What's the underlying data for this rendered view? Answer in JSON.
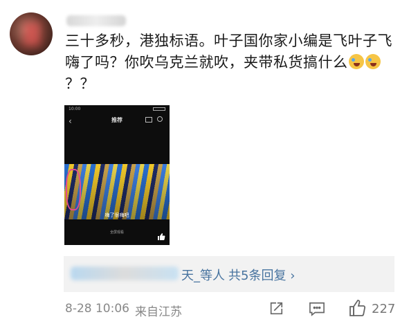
{
  "comment": {
    "text_main": "三十多秒，港独标语。叶子国你家小编是飞叶子飞嗨了吗？你吹乌克兰就吹，夹带私货搞什么",
    "text_tail": "？？",
    "emoji_icons": [
      "crying-laughing-emoji",
      "crying-laughing-emoji"
    ]
  },
  "phone_screenshot": {
    "status_time": "10:00",
    "back_icon": "‹",
    "title": "推荐",
    "subtitle": "嗨了很嗨吧",
    "footer": "全屏观看"
  },
  "replies": {
    "names_suffix": "天_等人",
    "count_text": "共5条回复",
    "chevron": "›"
  },
  "meta": {
    "time": "8-28 10:06",
    "location": "来自江苏",
    "like_count": "227"
  },
  "colors": {
    "link_blue": "#47739f",
    "meta_gray": "#888888",
    "reply_bg": "#f2f2f2"
  }
}
